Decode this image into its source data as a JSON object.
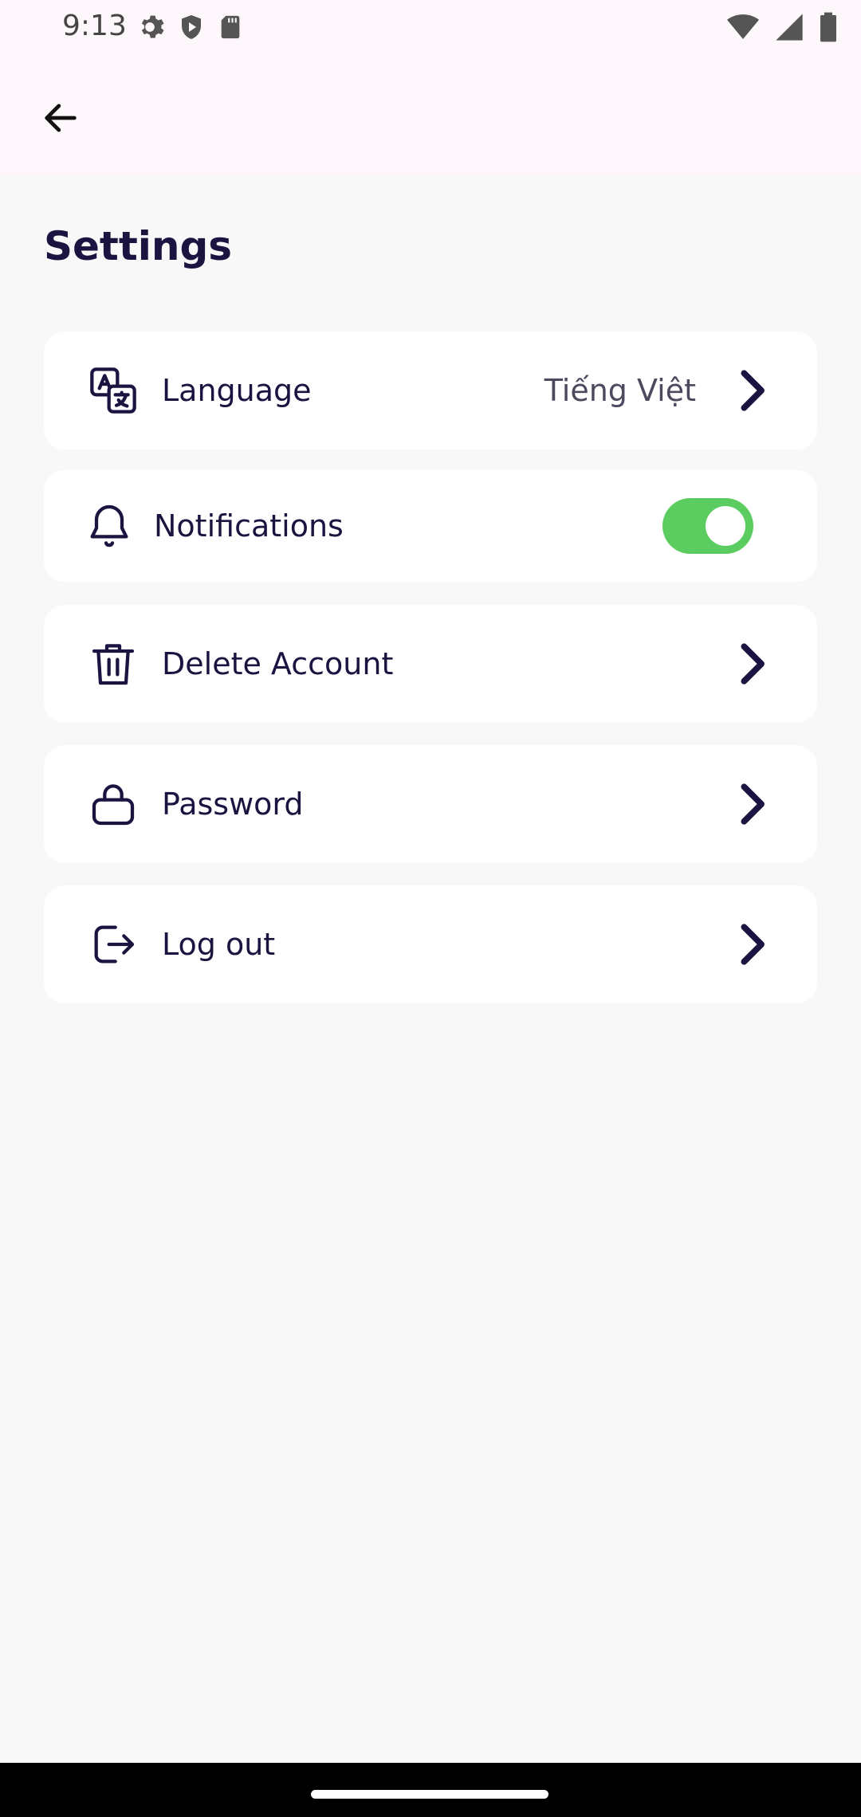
{
  "status": {
    "time": "9:13"
  },
  "page": {
    "title": "Settings"
  },
  "settings": {
    "language": {
      "label": "Language",
      "value": "Tiếng Việt"
    },
    "notifications": {
      "label": "Notifications",
      "enabled": true
    },
    "delete_account": {
      "label": "Delete Account"
    },
    "password": {
      "label": "Password"
    },
    "logout": {
      "label": "Log out"
    }
  },
  "icons": {
    "back": "arrow-left-icon",
    "language": "translate-icon",
    "notifications": "bell-icon",
    "delete_account": "trash-icon",
    "password": "lock-icon",
    "logout": "logout-icon",
    "chevron": "chevron-right-icon"
  },
  "colors": {
    "primary_text": "#1b1440",
    "toggle_on": "#5bcc5f",
    "card_bg": "#ffffff",
    "page_bg": "#f8f8f8"
  }
}
